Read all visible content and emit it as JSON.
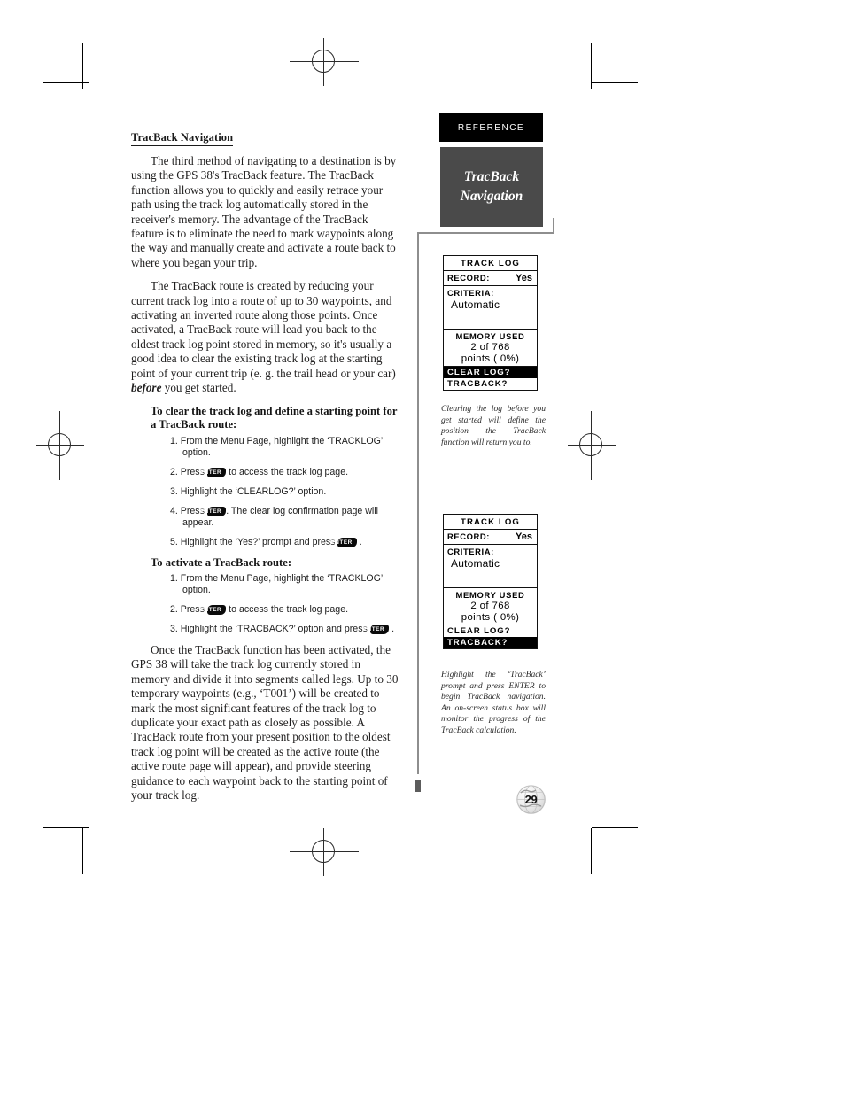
{
  "sidebar": {
    "reference_band": "REFERENCE",
    "chapter_line1": "TracBack",
    "chapter_line2": "Navigation"
  },
  "content": {
    "section_title": "TracBack Navigation",
    "para1": "The third method of navigating to a destination is by using the GPS 38's TracBack feature. The TracBack function allows you to quickly and easily retrace your path using the track log automatically stored in the receiver's memory. The advantage of the TracBack feature is to eliminate the need to mark waypoints along the way and manually create and activate a route back to where you began your trip.",
    "para2_a": "The TracBack route is created by reducing your current track log into a route of up to 30 waypoints, and activating an inverted route along those points. Once activated, a TracBack route will lead you back to the oldest track log point stored in memory, so it's usually a good idea to clear the existing track log at the starting point of your current trip (e. g. the trail head or your car) ",
    "para2_bold": "before",
    "para2_b": " you get started.",
    "proc1_heading": "To clear the track log and define a starting point for a TracBack route:",
    "proc1_steps": [
      {
        "num": "1.",
        "pre": "From the Menu Page, highlight the ‘TRACKLOG’ option.",
        "key": "",
        "post": ""
      },
      {
        "num": "2.",
        "pre": "Press ",
        "key": "ENTER",
        "post": " to access the track log page."
      },
      {
        "num": "3.",
        "pre": "Highlight the ‘CLEARLOG?’ option.",
        "key": "",
        "post": ""
      },
      {
        "num": "4.",
        "pre": "Press ",
        "key": "ENTER",
        "post": ". The clear log confirmation page will appear."
      },
      {
        "num": "5.",
        "pre": "Highlight the ‘Yes?’ prompt and press ",
        "key": "ENTER",
        "post": " ."
      }
    ],
    "proc2_heading": "To activate a TracBack route:",
    "proc2_steps": [
      {
        "num": "1.",
        "pre": "From the Menu Page, highlight the ‘TRACKLOG’ option.",
        "key": "",
        "post": ""
      },
      {
        "num": "2.",
        "pre": "Press ",
        "key": "ENTER",
        "post": " to access the track log page."
      },
      {
        "num": "3.",
        "pre": "Highlight the ‘TRACBACK?’ option and press ",
        "key": "ENTER",
        "post": " ."
      }
    ],
    "para3": "Once the TracBack function has been activated, the GPS 38 will take the track log currently stored in memory and divide it into segments called legs. Up to 30 temporary waypoints (e.g., ‘T001’) will be created to mark the most significant features of the track log to duplicate your exact path as closely as possible. A TracBack route from your present position to the oldest track log point will be created as the active route (the active route page will appear), and provide steering guidance to each waypoint back to the starting point of your track log."
  },
  "figure1": {
    "title": "TRACK LOG",
    "record_label": "RECORD:",
    "record_value": "Yes",
    "criteria_label": "CRITERIA:",
    "criteria_value": "Automatic",
    "memory_head": "MEMORY USED",
    "memory_line1": "2 of 768",
    "memory_line2": "points (  0%)",
    "option1": "CLEAR LOG?",
    "option1_selected": true,
    "option2": "TRACBACK?",
    "option2_selected": false,
    "caption": "Clearing the log before you get started will define the position the TracBack function will return you to."
  },
  "figure2": {
    "title": "TRACK LOG",
    "record_label": "RECORD:",
    "record_value": "Yes",
    "criteria_label": "CRITERIA:",
    "criteria_value": "Automatic",
    "memory_head": "MEMORY USED",
    "memory_line1": "2 of 768",
    "memory_line2": "points (  0%)",
    "option1": "CLEAR LOG?",
    "option1_selected": false,
    "option2": "TRACBACK?",
    "option2_selected": true,
    "caption": "Highlight the ‘TracBack’ prompt and press ENTER to begin TracBack navigation. An on-screen status box will monitor the progress of the TracBack calculation."
  },
  "page_number": "29",
  "colors": {
    "reference_band_bg": "#000000",
    "chapter_band_bg": "#4a4a4a",
    "rule_gray": "#8e8e8e",
    "text": "#201f1f"
  }
}
